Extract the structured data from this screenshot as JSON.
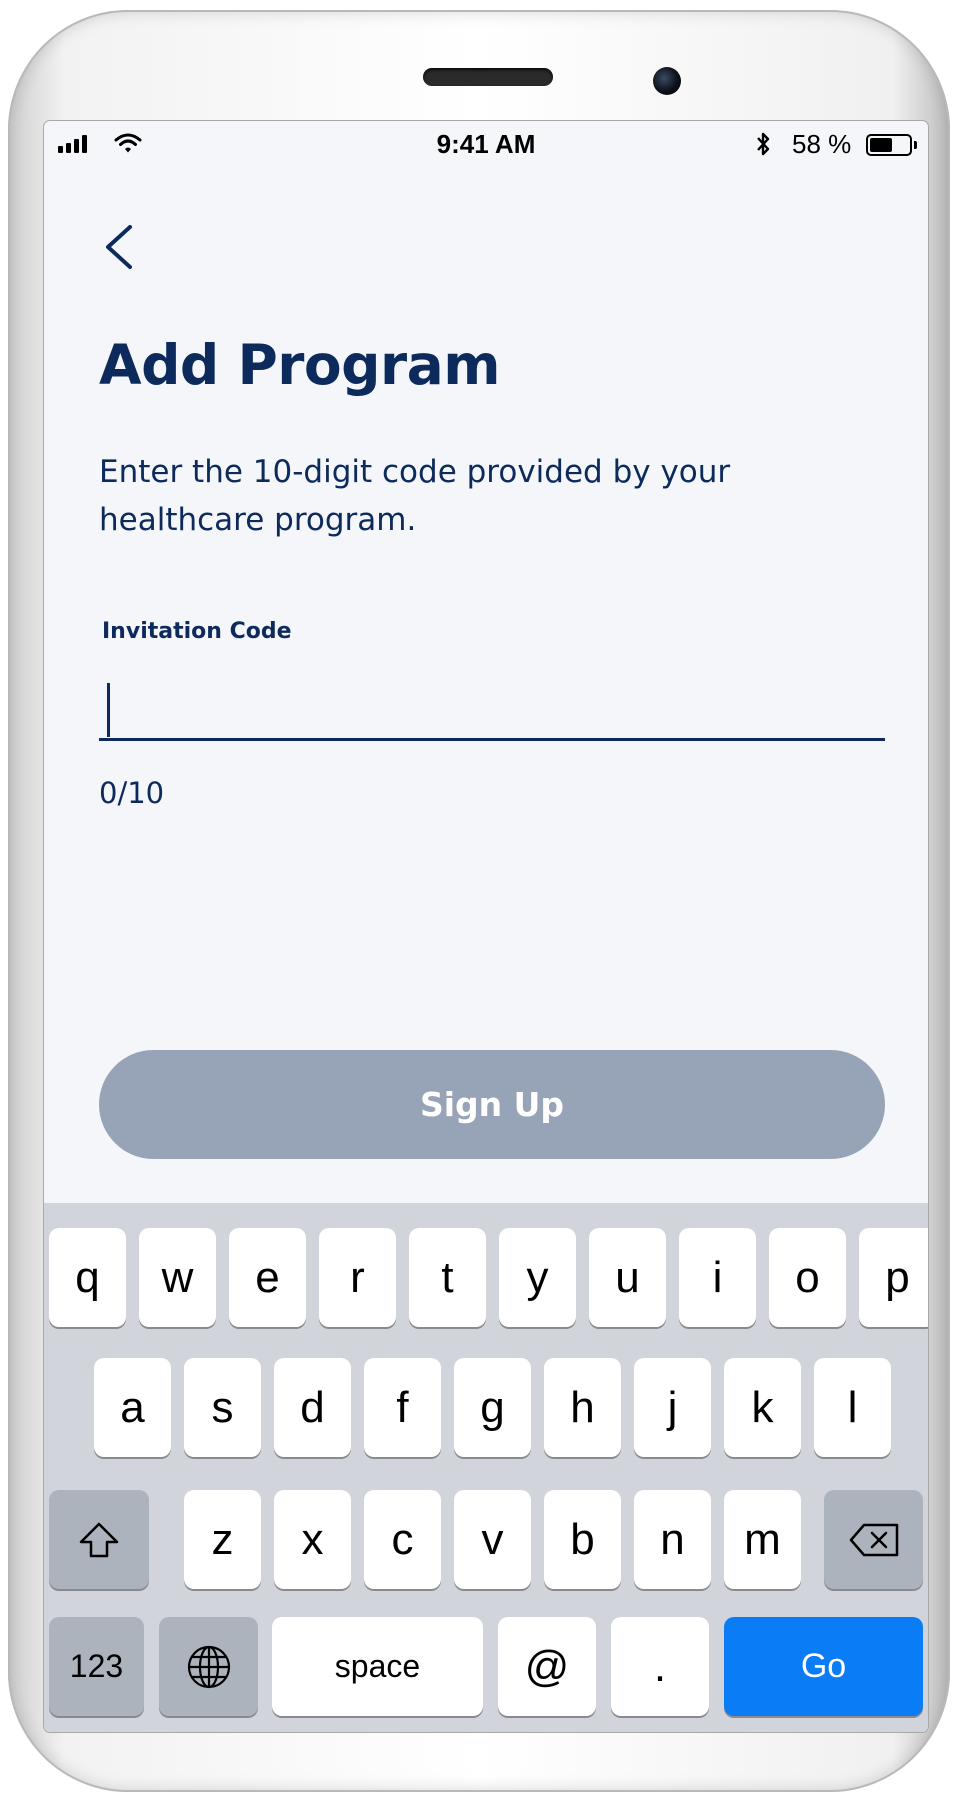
{
  "status_bar": {
    "time": "9:41 AM",
    "battery_percent": "58 %",
    "battery_level": 0.58,
    "icons": [
      "cellular-signal-icon",
      "wifi-icon",
      "bluetooth-icon",
      "battery-icon"
    ]
  },
  "header": {
    "back_icon": "chevron-left-icon",
    "title": "Add Program"
  },
  "form": {
    "description": "Enter the 10-digit code provided by your healthcare program.",
    "invitation_code": {
      "label": "Invitation Code",
      "value": "",
      "counter": "0/10"
    },
    "submit_label": "Sign Up"
  },
  "keyboard": {
    "row1": [
      "q",
      "w",
      "e",
      "r",
      "t",
      "y",
      "u",
      "i",
      "o",
      "p"
    ],
    "row2": [
      "a",
      "s",
      "d",
      "f",
      "g",
      "h",
      "j",
      "k",
      "l"
    ],
    "row3": [
      "z",
      "x",
      "c",
      "v",
      "b",
      "n",
      "m"
    ],
    "shift_icon": "shift-icon",
    "delete_icon": "backspace-icon",
    "numbers_label": "123",
    "globe_icon": "globe-icon",
    "space_label": "space",
    "at_label": "@",
    "period_label": ".",
    "go_label": "Go"
  },
  "colors": {
    "primary": "#0d2a5c",
    "button_disabled": "#97a4b7",
    "keyboard_go": "#0a7cf5",
    "background": "#f4f6f9"
  }
}
